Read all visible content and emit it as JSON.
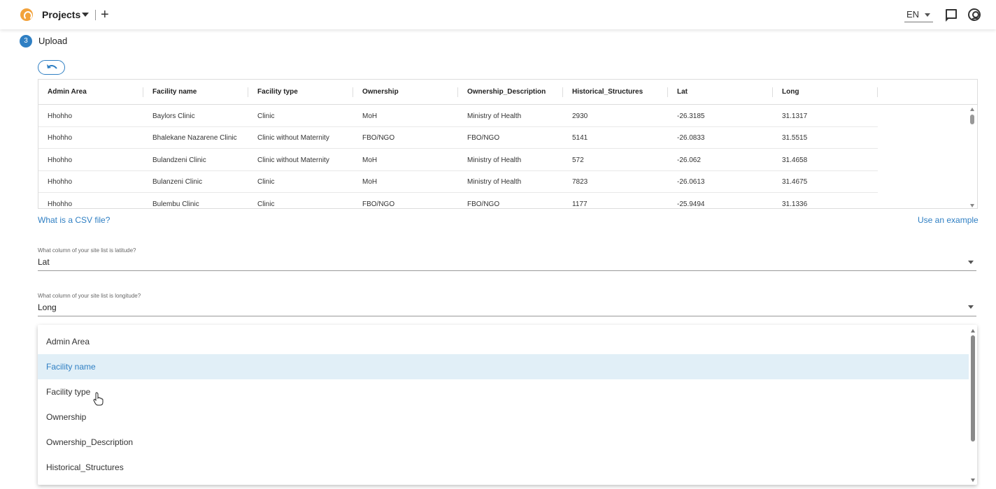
{
  "topbar": {
    "projects_label": "Projects",
    "add_label": "+",
    "language": "EN"
  },
  "step": {
    "number": "3",
    "label": "Upload"
  },
  "table": {
    "headers": [
      "Admin Area",
      "Facility name",
      "Facility type",
      "Ownership",
      "Ownership_Description",
      "Historical_Structures",
      "Lat",
      "Long"
    ],
    "rows": [
      [
        "Hhohho",
        "Baylors Clinic",
        "Clinic",
        "MoH",
        "Ministry of Health",
        "2930",
        "-26.3185",
        "31.1317"
      ],
      [
        "Hhohho",
        "Bhalekane Nazarene Clinic",
        "Clinic without Maternity",
        "FBO/NGO",
        "FBO/NGO",
        "5141",
        "-26.0833",
        "31.5515"
      ],
      [
        "Hhohho",
        "Bulandzeni Clinic",
        "Clinic without Maternity",
        "MoH",
        "Ministry of Health",
        "572",
        "-26.062",
        "31.4658"
      ],
      [
        "Hhohho",
        "Bulanzeni Clinic",
        "Clinic",
        "MoH",
        "Ministry of Health",
        "7823",
        "-26.0613",
        "31.4675"
      ],
      [
        "Hhohho",
        "Bulembu Clinic",
        "Clinic",
        "FBO/NGO",
        "FBO/NGO",
        "1177",
        "-25.9494",
        "31.1336"
      ]
    ]
  },
  "links": {
    "csv_help": "What is a CSV file?",
    "use_example": "Use an example"
  },
  "latitude_field": {
    "label": "What column of your site list is latitude?",
    "value": "Lat"
  },
  "longitude_field": {
    "label": "What column of your site list is longitude?",
    "value": "Long"
  },
  "dropdown": {
    "options": [
      "Admin Area",
      "Facility name",
      "Facility type",
      "Ownership",
      "Ownership_Description",
      "Historical_Structures"
    ],
    "highlighted": "Facility name"
  },
  "colors": {
    "accent": "#2f7fc3",
    "highlight_bg": "#e1eff7",
    "logo": "#f2a23b"
  }
}
